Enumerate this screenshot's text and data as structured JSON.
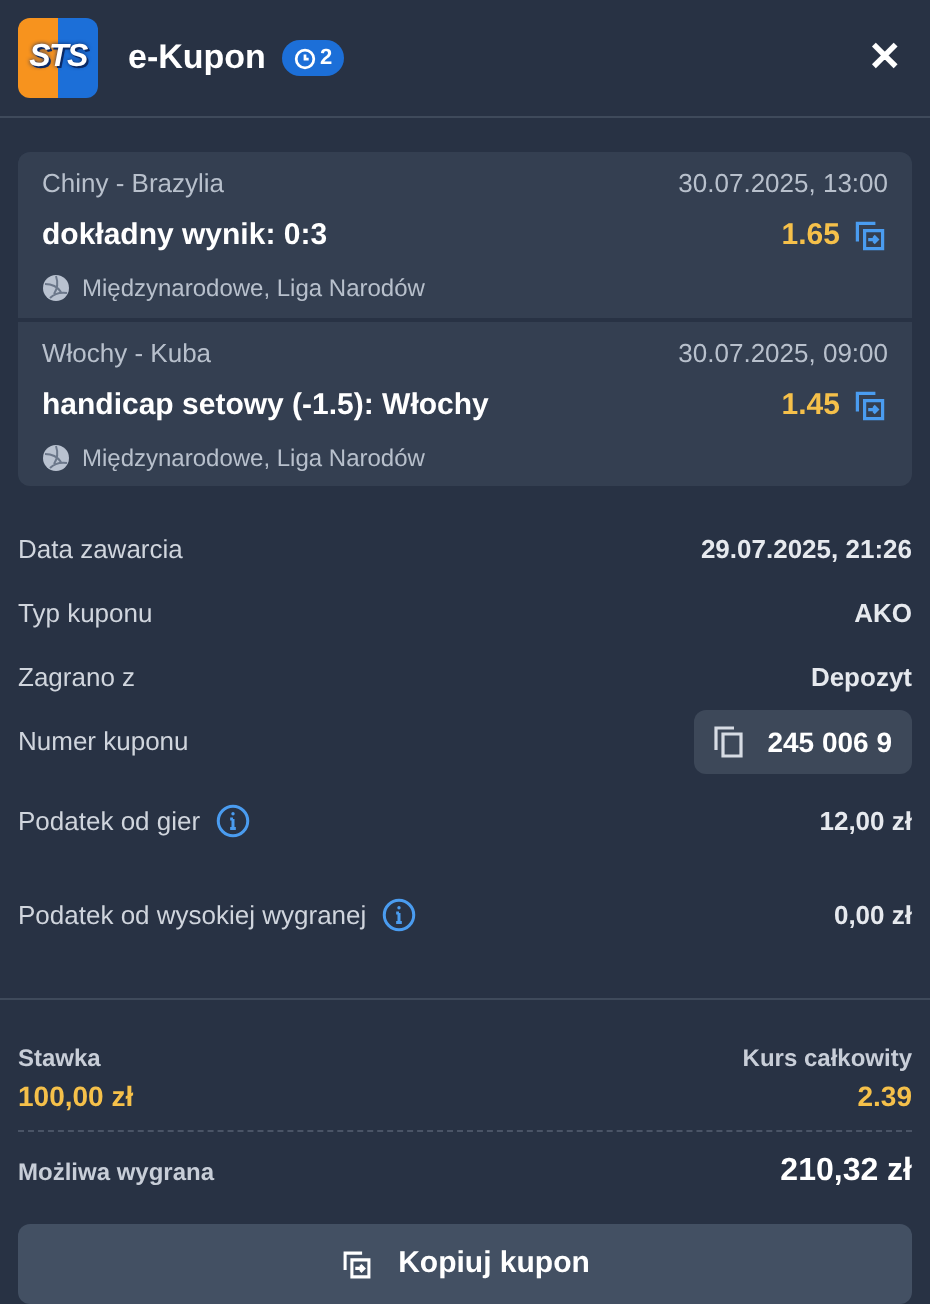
{
  "header": {
    "logo": "STS",
    "title": "e-Kupon",
    "badge": "2",
    "close": "✕"
  },
  "events": [
    {
      "teams": "Chiny - Brazylia",
      "datetime": "30.07.2025, 13:00",
      "bet": "dokładny wynik: 0:3",
      "odds": "1.65",
      "league": "Międzynarodowe, Liga Narodów"
    },
    {
      "teams": "Włochy - Kuba",
      "datetime": "30.07.2025, 09:00",
      "bet": "handicap setowy (-1.5): Włochy",
      "odds": "1.45",
      "league": "Międzynarodowe, Liga Narodów"
    }
  ],
  "details": [
    {
      "kind": "plain",
      "label": "Data zawarcia",
      "value": "29.07.2025, 21:26"
    },
    {
      "kind": "plain",
      "label": "Typ kuponu",
      "value": "AKO"
    },
    {
      "kind": "plain",
      "label": "Zagrano z",
      "value": "Depozyt"
    },
    {
      "kind": "copy",
      "label": "Numer kuponu",
      "value": "245 006 9"
    },
    {
      "kind": "info",
      "label": "Podatek od gier",
      "value": "12,00 zł"
    },
    {
      "kind": "info",
      "label": "Podatek od wysokiej wygranej",
      "value": "0,00 zł"
    }
  ],
  "summary": {
    "stake_label": "Stawka",
    "stake": "100,00 zł",
    "odds_label": "Kurs całkowity",
    "odds": "2.39",
    "win_label": "Możliwa wygrana",
    "win": "210,32 zł"
  },
  "button": "Kopiuj kupon"
}
